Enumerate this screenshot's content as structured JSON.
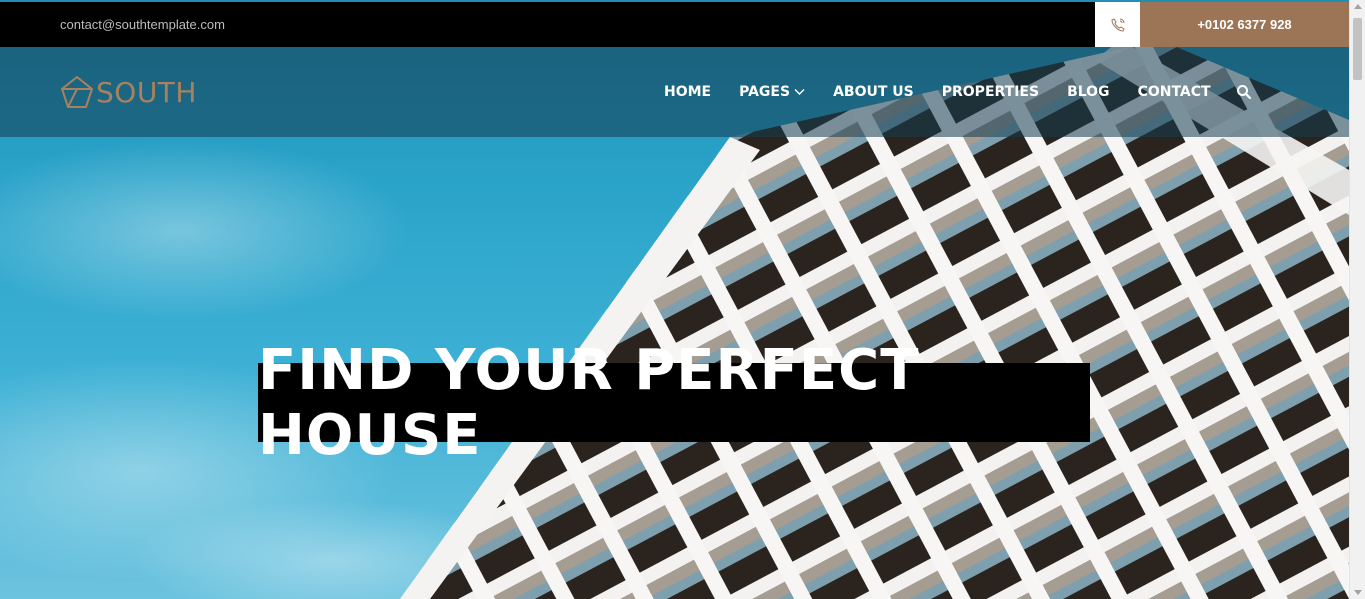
{
  "topbar": {
    "email": "contact@southtemplate.com",
    "phone": "+0102 6377 928",
    "phone_icon": "phone-icon"
  },
  "brand": {
    "name": "SOUTH",
    "logo_icon": "house-outline-icon",
    "color": "#a8825f"
  },
  "nav": {
    "items": [
      {
        "label": "HOME"
      },
      {
        "label": "PAGES"
      },
      {
        "label": "ABOUT US"
      },
      {
        "label": "PROPERTIES"
      },
      {
        "label": "BLOG"
      },
      {
        "label": "CONTACT"
      }
    ],
    "search_icon": "search-icon"
  },
  "hero": {
    "headline": "FIND YOUR PERFECT HOUSE"
  },
  "colors": {
    "accent": "#9b7556",
    "topbar_bg": "#000000",
    "sky": "#2aa3c9"
  }
}
